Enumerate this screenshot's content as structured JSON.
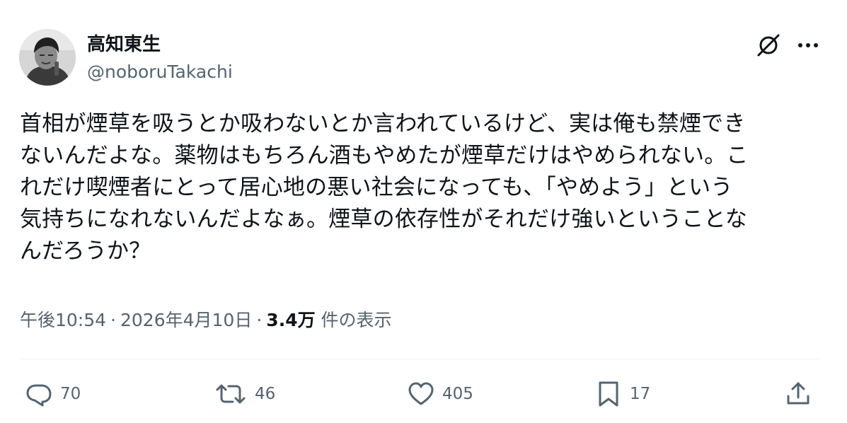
{
  "author": {
    "display_name": "高知東生",
    "handle": "@noboruTakachi"
  },
  "header_actions": {
    "grok_icon": "grok-icon",
    "more_icon": "more-icon"
  },
  "post": {
    "lines": [
      "首相が煙草を吸うとか吸わないとか言われているけど、実は俺も禁煙でき",
      "ないんだよな。薬物はもちろん酒もやめたが煙草だけはやめられない。こ",
      "れだけ喫煙者にとって居心地の悪い社会になっても、「やめよう」という",
      "気持ちになれないんだよなぁ。煙草の依存性がそれだけ強いということな",
      "んだろうか？"
    ]
  },
  "meta": {
    "time": "午後10:54",
    "separator": "·",
    "date": "2026年4月10日",
    "views_count": "3.4万",
    "views_label": "件の表示"
  },
  "actions": {
    "replies": "70",
    "reposts": "46",
    "likes": "405",
    "bookmarks": "17"
  },
  "colors": {
    "text": "#0f1419",
    "secondary": "#536471",
    "divider": "#eff3f4"
  }
}
